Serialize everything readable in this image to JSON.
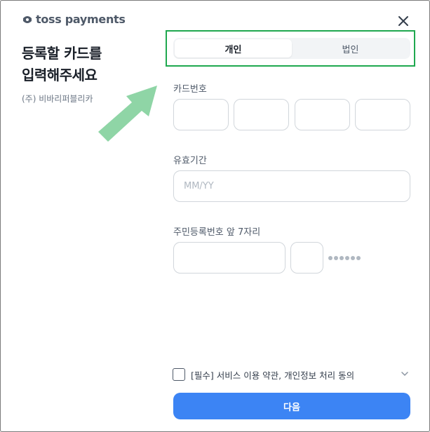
{
  "brand": {
    "name": "toss payments",
    "logo_icon": "toss-logo-icon"
  },
  "close": {
    "icon": "close-icon"
  },
  "heading": {
    "line1": "등록할 카드를",
    "line2": "입력해주세요"
  },
  "merchant": "(주) 비바리퍼블리카",
  "tabs": [
    {
      "label": "개인",
      "active": true
    },
    {
      "label": "법인",
      "active": false
    }
  ],
  "card_number": {
    "label": "카드번호",
    "segments": [
      "",
      "",
      "",
      ""
    ]
  },
  "expiry": {
    "label": "유효기간",
    "placeholder": "MM/YY",
    "value": ""
  },
  "resident_number": {
    "label": "주민등록번호 앞 7자리",
    "masked_digits": 6
  },
  "agreement": {
    "text": "[필수] 서비스 이용 약관, 개인정보 처리 동의",
    "checked": false
  },
  "next_button": "다음",
  "colors": {
    "accent": "#3c84f4",
    "highlight": "#1fa84f",
    "arrow": "#8fd5a6"
  }
}
